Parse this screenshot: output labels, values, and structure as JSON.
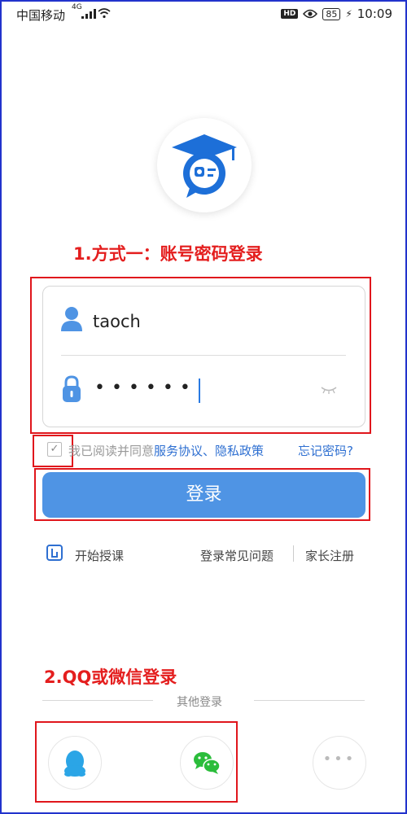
{
  "status_bar": {
    "carrier": "中国移动",
    "network": "4G",
    "hd": "HD",
    "battery": "85",
    "time": "10:09"
  },
  "annotations": {
    "method1": "1.方式一：账号密码登录",
    "method2": "2.QQ或微信登录"
  },
  "login_form": {
    "username_value": "taoch",
    "password_masked": "••••••"
  },
  "agreement": {
    "prefix": "我已阅读并同意",
    "terms_link": "服务协议、隐私政策",
    "forgot_password": "忘记密码?"
  },
  "login_button_label": "登录",
  "links": {
    "start_teaching": "开始授课",
    "faq": "登录常见问题",
    "parent_register": "家长注册"
  },
  "other_login": {
    "label": "其他登录",
    "options": [
      "qq-icon",
      "wechat-icon",
      "more-icon"
    ]
  },
  "colors": {
    "primary": "#4f94e4",
    "link": "#2e6fd1",
    "annotation_red": "#e41e1e",
    "frame_blue": "#2233cc",
    "qq_blue": "#2ba5e6",
    "wechat_green": "#2bbd3b"
  }
}
